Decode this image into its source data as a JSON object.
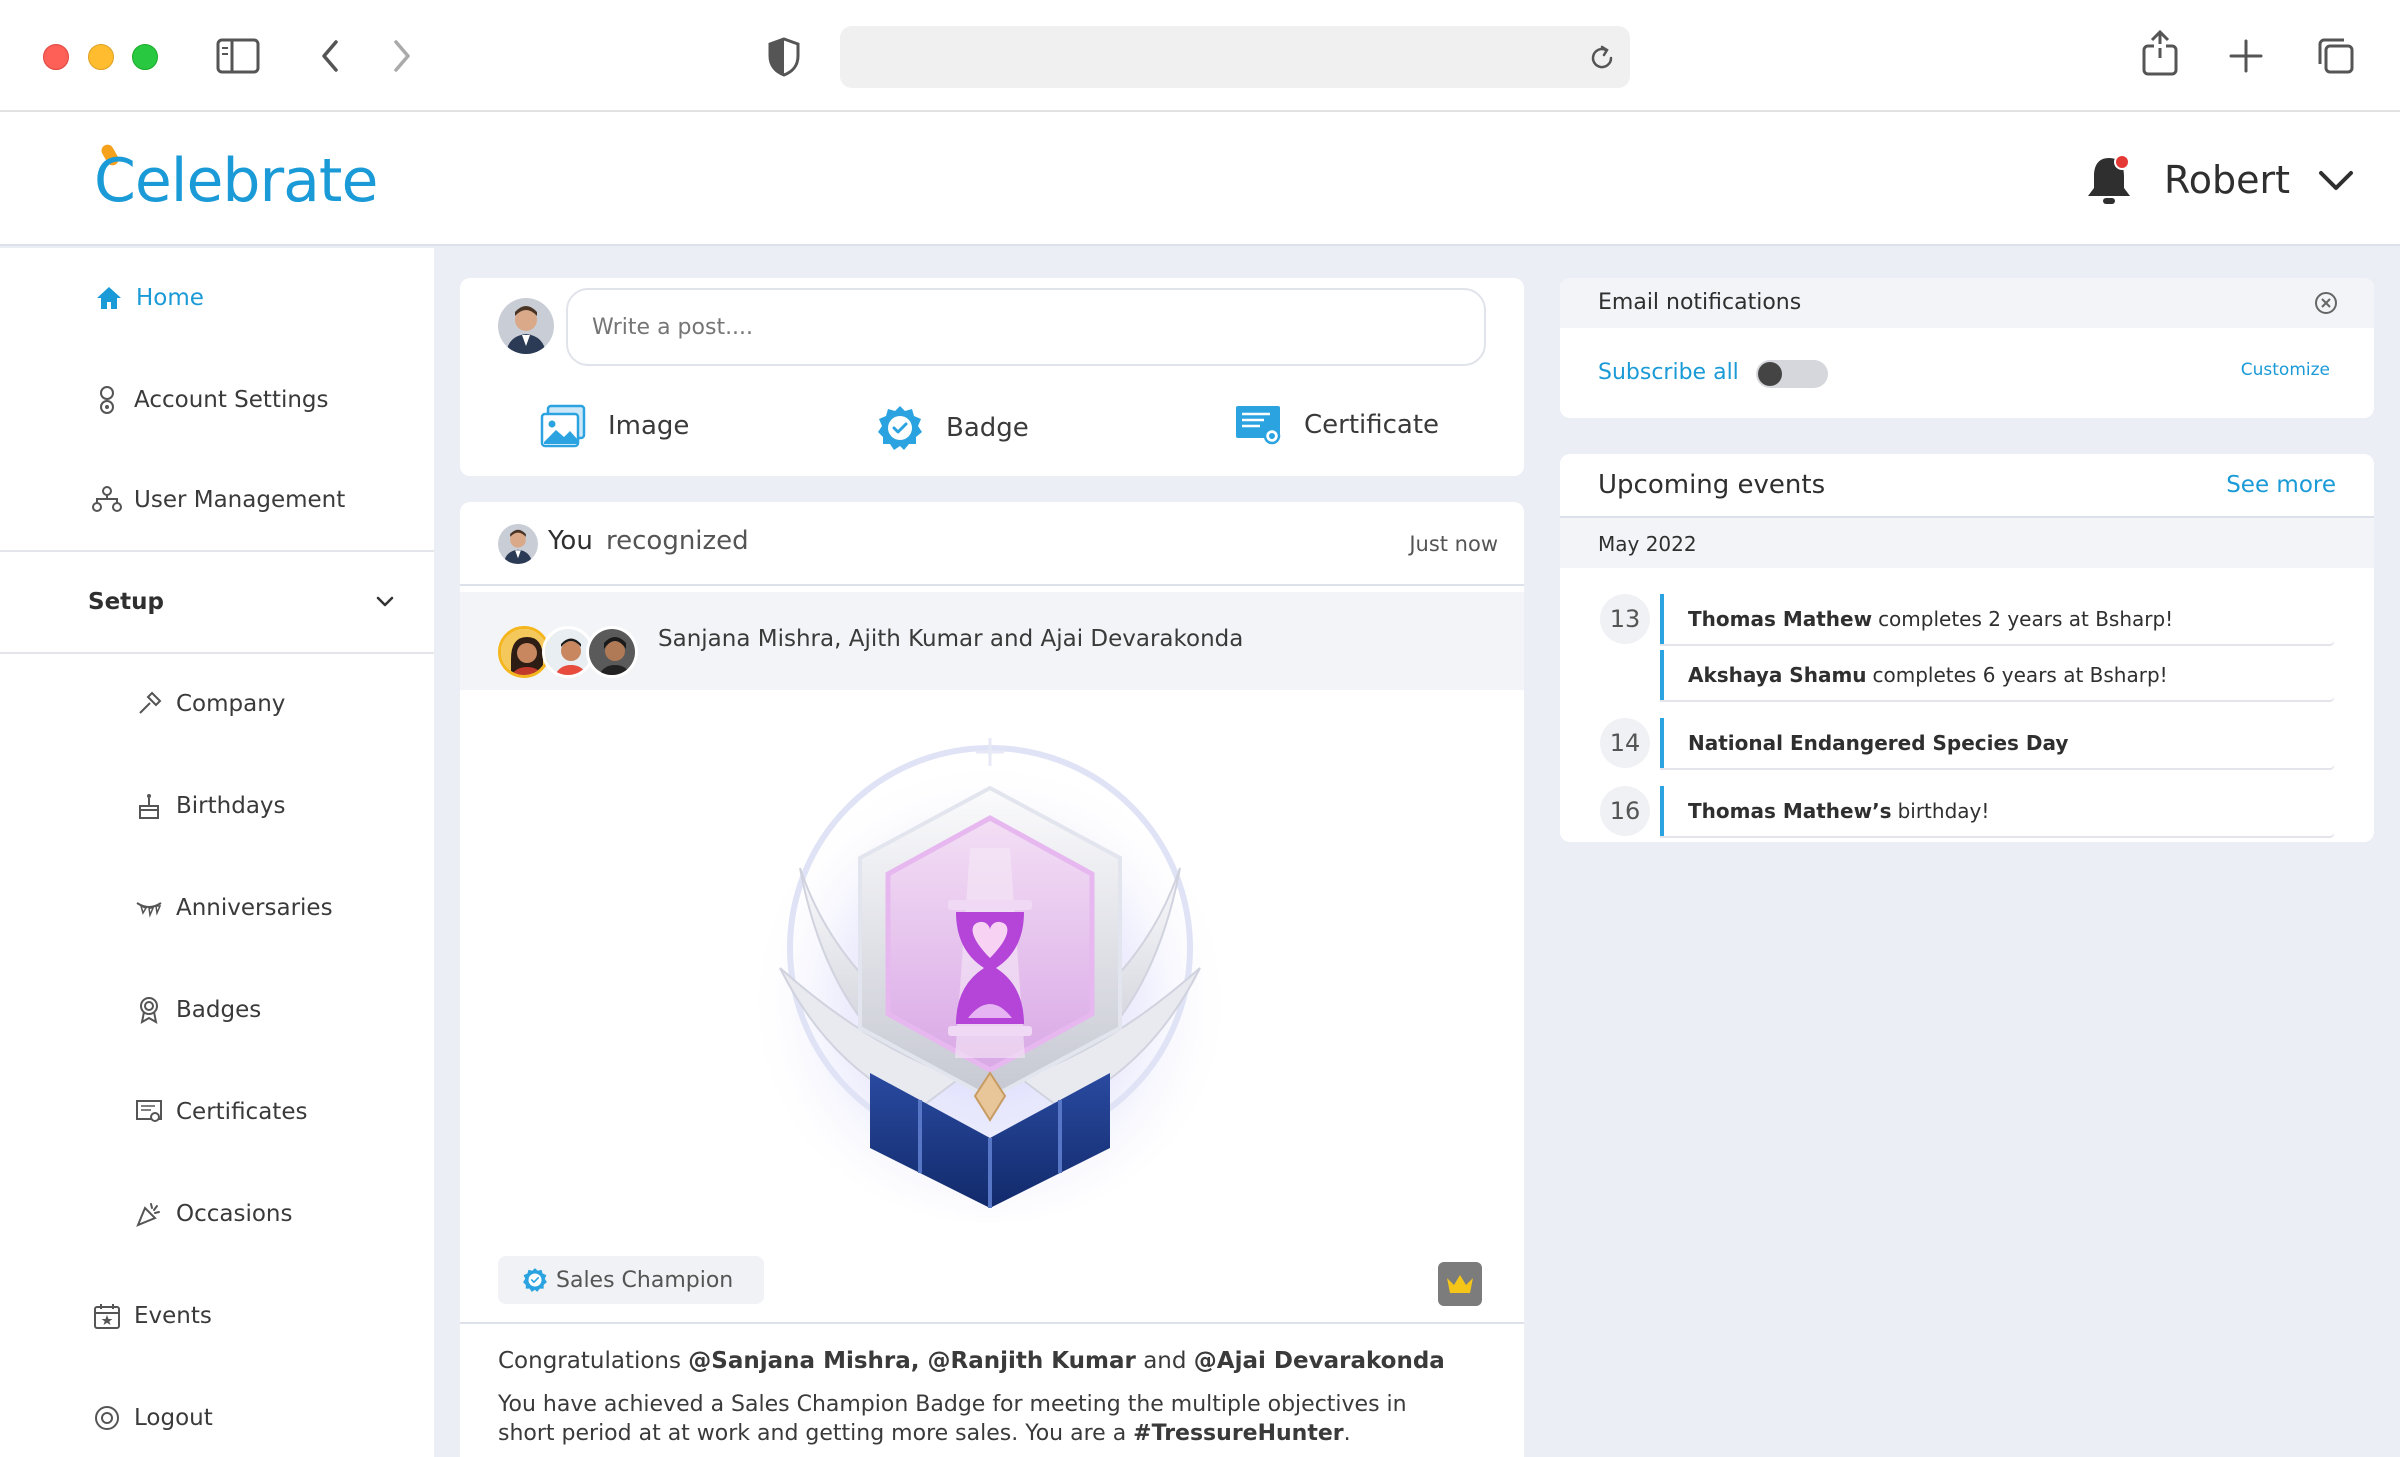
{
  "browser": {
    "url": ""
  },
  "app": {
    "logo_text": "Celebrate",
    "user_name": "Robert"
  },
  "sidebar": {
    "items": [
      {
        "label": "Home",
        "active": true
      },
      {
        "label": "Account Settings"
      },
      {
        "label": "User Management"
      }
    ],
    "setup_label": "Setup",
    "setup_items": [
      {
        "label": "Company"
      },
      {
        "label": "Birthdays"
      },
      {
        "label": "Anniversaries"
      },
      {
        "label": "Badges"
      },
      {
        "label": "Certificates"
      },
      {
        "label": "Occasions"
      }
    ],
    "bottom_items": [
      {
        "label": "Events"
      },
      {
        "label": "Logout"
      }
    ]
  },
  "composer": {
    "placeholder": "Write a post....",
    "actions": [
      {
        "label": "Image",
        "icon": "image-icon"
      },
      {
        "label": "Badge",
        "icon": "badge-icon"
      },
      {
        "label": "Certificate",
        "icon": "certificate-icon"
      }
    ]
  },
  "feed": {
    "you": "You",
    "action": "recognized",
    "time": "Just now",
    "recipients": "Sanjana Mishra, Ajith Kumar and Ajai Devarakonda",
    "badge_name": "Sales Champion",
    "congrats_prefix": "Congratulations",
    "congrats_mentions_1": "@Sanjana Mishra, @Ranjith Kumar",
    "congrats_and": "and",
    "congrats_mentions_2": "@Ajai Devarakonda",
    "achieve_text": "You have achieved a Sales Champion Badge for meeting the multiple objectives in short period at at work and getting more sales. You are a",
    "hashtag": "#TressureHunter",
    "achieve_end": "."
  },
  "email_notifications": {
    "title": "Email notifications",
    "subscribe_label": "Subscribe all",
    "subscribed": false,
    "customize_label": "Customize"
  },
  "events": {
    "title": "Upcoming events",
    "see_more": "See more",
    "month": "May 2022",
    "items": [
      {
        "day": "13",
        "name": "Thomas Mathew",
        "text": "completes 2 years at Bsharp!"
      },
      {
        "day": "",
        "name": "Akshaya Shamu",
        "text": "completes 6 years at Bsharp!"
      },
      {
        "day": "14",
        "name": "National Endangered Species Day",
        "text": ""
      },
      {
        "day": "16",
        "name": "Thomas Mathew’s",
        "text": "birthday!"
      }
    ]
  },
  "colors": {
    "accent": "#1a9ad6",
    "page_bg": "#eceef5",
    "event_bar": "#2aa3e0",
    "notification_dot": "#e53935"
  }
}
